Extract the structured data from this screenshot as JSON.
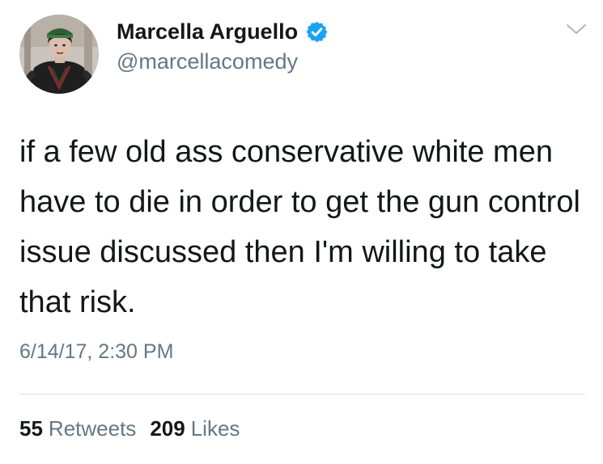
{
  "author": {
    "display_name": "Marcella Arguello",
    "handle": "@marcellacomedy",
    "verified": true,
    "avatar_icon": "profile-photo"
  },
  "tweet": {
    "text": "if a few old ass conservative white men have to die in order to get the gun control issue discussed then I'm willing to take that risk.",
    "timestamp": "6/14/17, 2:30 PM"
  },
  "stats": {
    "retweets_count": "55",
    "retweets_label": "Retweets",
    "likes_count": "209",
    "likes_label": "Likes"
  },
  "colors": {
    "text": "#14171a",
    "secondary_text": "#657786",
    "verified_badge": "#1da1f2",
    "divider": "#dbe1e6"
  },
  "icons": {
    "menu": "chevron-down-icon",
    "verified": "verified-badge-icon"
  }
}
